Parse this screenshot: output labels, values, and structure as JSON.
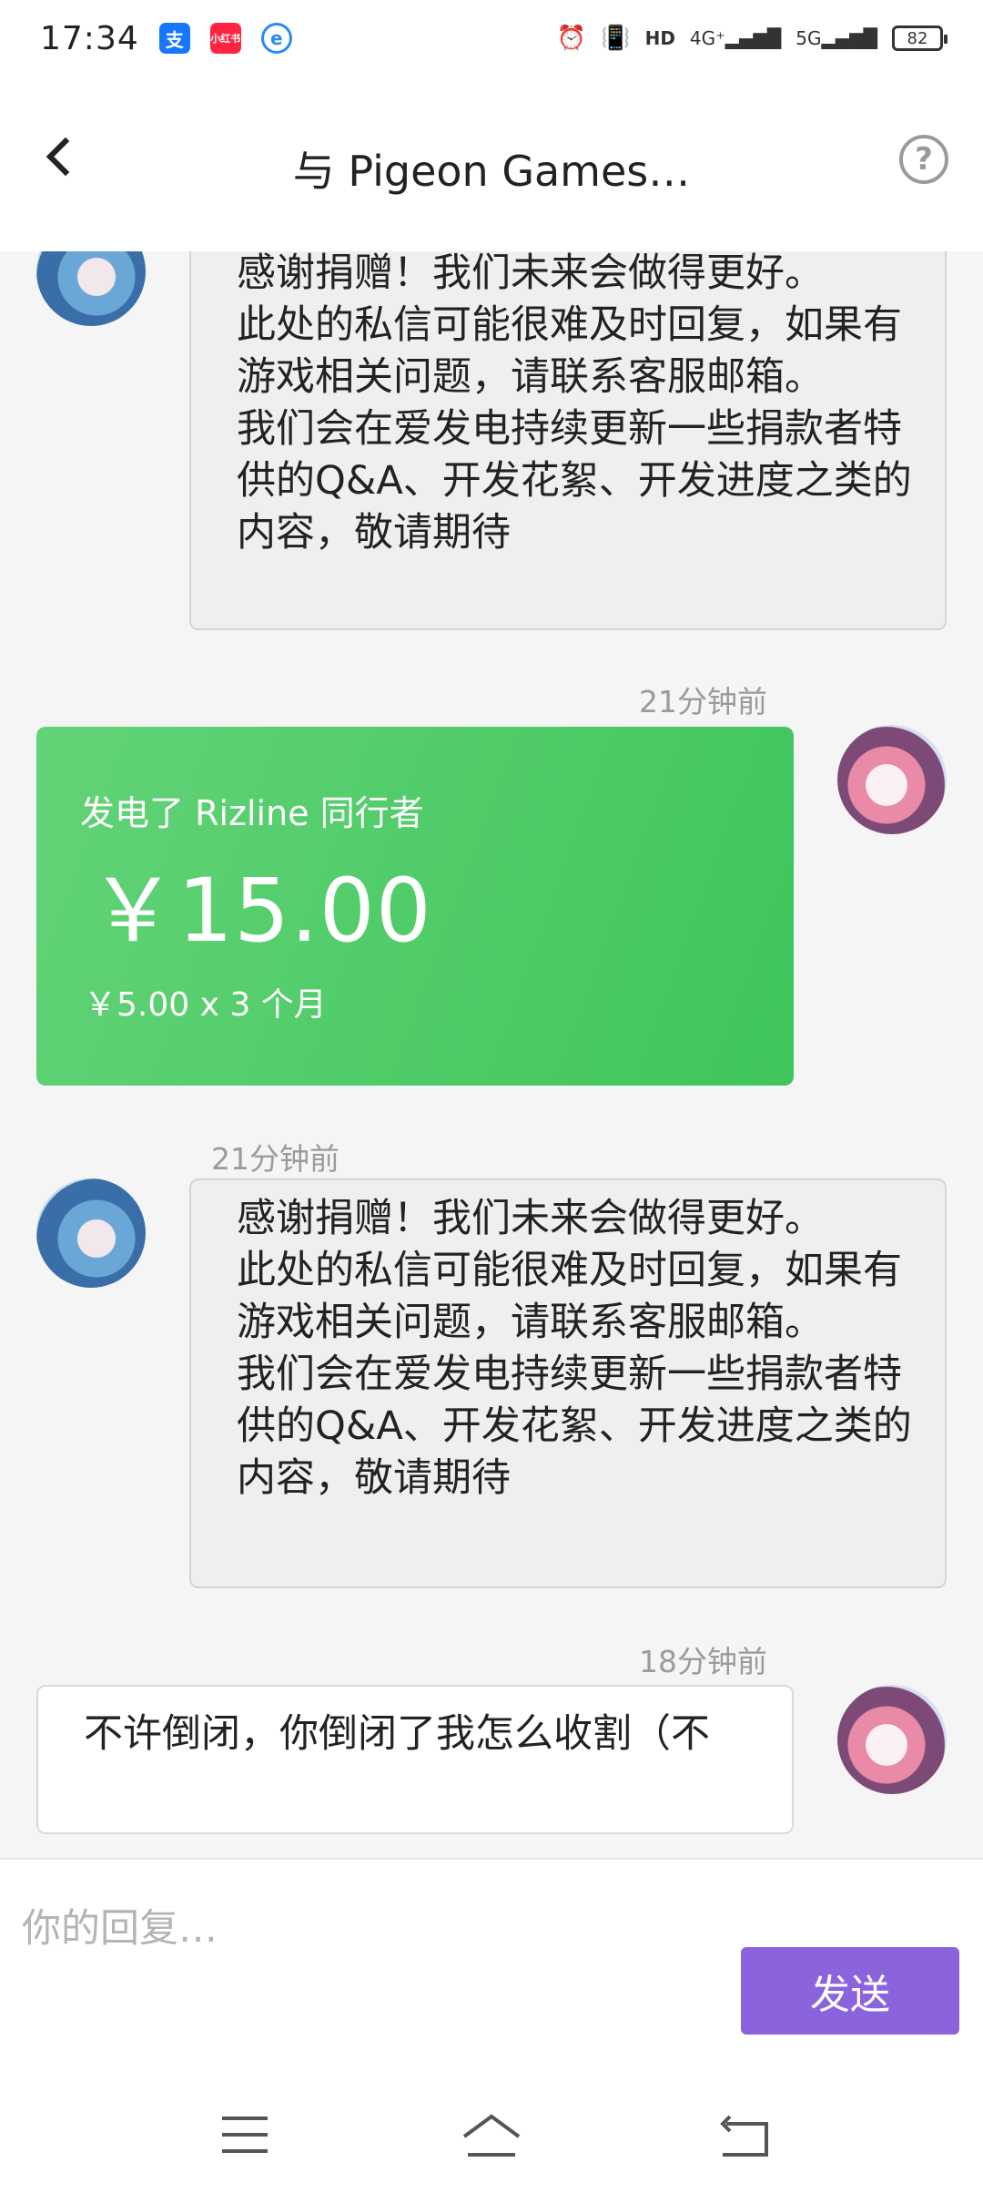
{
  "status_bar": {
    "time": "17:34",
    "apps": [
      {
        "name": "alipay-icon",
        "glyph": "支",
        "color": "#1677ff"
      },
      {
        "name": "xiaohongshu-icon",
        "glyph": "小红书",
        "color": "#ff2442"
      },
      {
        "name": "browser-icon",
        "glyph": "e",
        "color": "#2a8bf2"
      }
    ],
    "network": "4G⁺",
    "network2": "5G",
    "battery": "82"
  },
  "header": {
    "title": "与 Pigeon Games…"
  },
  "messages": {
    "first_bubble": "感谢捐赠！我们未来会做得更好。\n此处的私信可能很难及时回复，如果有游戏相关问题，请联系客服邮箱。\n我们会在爱发电持续更新一些捐款者特供的Q&A、开发花絮、开发进度之类的内容，敬请期待",
    "time_1": "21分钟前",
    "donation": {
      "title": "发电了 Rizline 同行者",
      "amount": "￥15.00",
      "detail": "￥5.00 x 3 个月"
    },
    "time_2": "21分钟前",
    "second_bubble": "感谢捐赠！我们未来会做得更好。\n此处的私信可能很难及时回复，如果有游戏相关问题，请联系客服邮箱。\n我们会在爱发电持续更新一些捐款者特供的Q&A、开发花絮、开发进度之类的内容，敬请期待",
    "time_3": "18分钟前",
    "my_reply": "不许倒闭，你倒闭了我怎么收割（不"
  },
  "composer": {
    "placeholder": "你的回复…",
    "send_label": "发送"
  }
}
